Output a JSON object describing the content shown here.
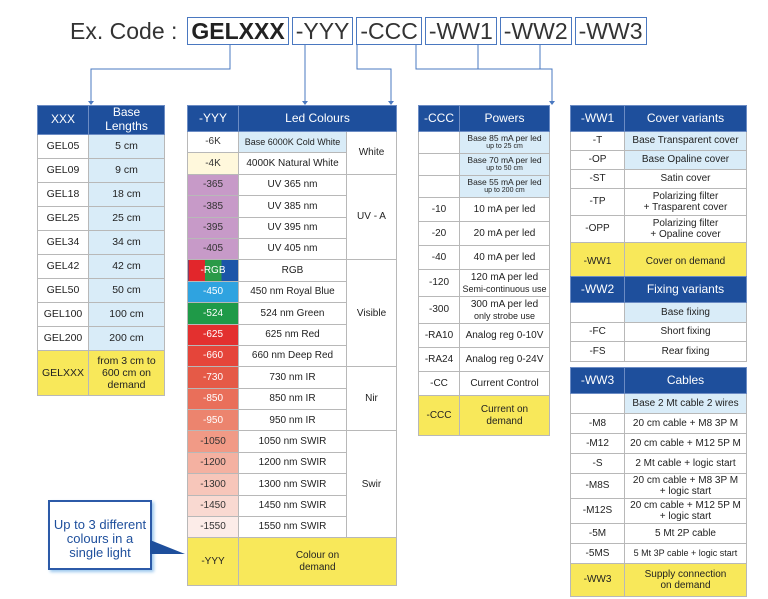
{
  "code": {
    "label": "Ex. Code :",
    "segments": [
      "GELXXX",
      "-YYY",
      "-CCC",
      "-WW1",
      "-WW2",
      "-WW3"
    ]
  },
  "colors": {
    "header_bg": "#1e4f9c",
    "base_highlight": "#d9ecf8",
    "on_demand": "#f8e85a",
    "uv": "#c79ac8"
  },
  "lengths": {
    "headers": [
      "XXX",
      "Base Lengths"
    ],
    "rows": [
      {
        "code": "GEL05",
        "value": "5 cm"
      },
      {
        "code": "GEL09",
        "value": "9 cm"
      },
      {
        "code": "GEL18",
        "value": "18 cm"
      },
      {
        "code": "GEL25",
        "value": "25 cm"
      },
      {
        "code": "GEL34",
        "value": "34 cm"
      },
      {
        "code": "GEL42",
        "value": "42 cm"
      },
      {
        "code": "GEL50",
        "value": "50 cm"
      },
      {
        "code": "GEL100",
        "value": "100 cm"
      },
      {
        "code": "GEL200",
        "value": "200 cm"
      }
    ],
    "demand": {
      "code": "GELXXX",
      "value": "from 3 cm to 600 cm on demand"
    }
  },
  "led": {
    "headers": [
      "-YYY",
      "Led Colours"
    ],
    "rows": [
      {
        "code": "-6K",
        "value": "Base 6000K Cold White"
      },
      {
        "code": "-4K",
        "value": "4000K Natural White"
      },
      {
        "code": "-365",
        "value": "UV 365 nm"
      },
      {
        "code": "-385",
        "value": "UV 385 nm"
      },
      {
        "code": "-395",
        "value": "UV 395 nm"
      },
      {
        "code": "-405",
        "value": "UV 405 nm"
      },
      {
        "code": "-RGB",
        "value": "RGB"
      },
      {
        "code": "-450",
        "value": "450 nm Royal Blue"
      },
      {
        "code": "-524",
        "value": "524 nm Green"
      },
      {
        "code": "-625",
        "value": "625 nm Red"
      },
      {
        "code": "-660",
        "value": "660 nm Deep Red"
      },
      {
        "code": "-730",
        "value": "730 nm IR"
      },
      {
        "code": "-850",
        "value": "850 nm IR"
      },
      {
        "code": "-950",
        "value": "950 nm IR"
      },
      {
        "code": "-1050",
        "value": "1050 nm SWIR"
      },
      {
        "code": "-1200",
        "value": "1200 nm SWIR"
      },
      {
        "code": "-1300",
        "value": "1300 nm SWIR"
      },
      {
        "code": "-1450",
        "value": "1450 nm SWIR"
      },
      {
        "code": "-1550",
        "value": "1550 nm SWIR"
      }
    ],
    "groups": [
      "White",
      "UV - A",
      "Visible",
      "Nir",
      "Swir"
    ],
    "demand": {
      "code": "-YYY",
      "value": "Colour on demand"
    }
  },
  "powers": {
    "headers": [
      "-CCC",
      "Powers"
    ],
    "base_rows": [
      {
        "value": "Base 85 mA per led",
        "note": "up to 25 cm"
      },
      {
        "value": "Base 70 mA per led",
        "note": "up to 50 cm"
      },
      {
        "value": "Base 55 mA per led",
        "note": "up to 200 cm"
      }
    ],
    "rows": [
      {
        "code": "-10",
        "value": "10 mA per led"
      },
      {
        "code": "-20",
        "value": "20 mA per led"
      },
      {
        "code": "-40",
        "value": "40 mA per led"
      },
      {
        "code": "-120",
        "value": "120 mA per led",
        "note": "Semi-continuous use"
      },
      {
        "code": "-300",
        "value": "300 mA per led",
        "note": "only strobe use"
      },
      {
        "code": "-RA10",
        "value": "Analog reg 0-10V"
      },
      {
        "code": "-RA24",
        "value": "Analog reg 0-24V"
      },
      {
        "code": "-CC",
        "value": "Current Control"
      }
    ],
    "demand": {
      "code": "-CCC",
      "value": "Current on demand"
    }
  },
  "covers": {
    "headers": [
      "-WW1",
      "Cover variants"
    ],
    "rows": [
      {
        "code": "-T",
        "value": "Base Transparent cover"
      },
      {
        "code": "-OP",
        "value": "Base Opaline cover"
      },
      {
        "code": "-ST",
        "value": "Satin cover"
      },
      {
        "code": "-TP",
        "value": "Polarizing filter",
        "value2": "+ Trasparent cover"
      },
      {
        "code": "-OPP",
        "value": "Polarizing filter",
        "value2": "+ Opaline cover"
      }
    ],
    "demand": {
      "code": "-WW1",
      "value": "Cover on demand"
    }
  },
  "fixing": {
    "headers": [
      "-WW2",
      "Fixing variants"
    ],
    "rows": [
      {
        "code": "",
        "value": "Base fixing"
      },
      {
        "code": "-FC",
        "value": "Short fixing"
      },
      {
        "code": "-FS",
        "value": "Rear fixing"
      }
    ]
  },
  "cables": {
    "headers": [
      "-WW3",
      "Cables"
    ],
    "rows": [
      {
        "code": "",
        "value": "Base 2 Mt cable 2 wires"
      },
      {
        "code": "-M8",
        "value": "20 cm cable + M8 3P M"
      },
      {
        "code": "-M12",
        "value": "20 cm cable + M12 5P M"
      },
      {
        "code": "-S",
        "value": "2 Mt cable + logic start"
      },
      {
        "code": "-M8S",
        "value": "20 cm cable + M8 3P M",
        "value2": "+ logic start"
      },
      {
        "code": "-M12S",
        "value": "20 cm cable + M12 5P M",
        "value2": "+ logic start"
      },
      {
        "code": "-5M",
        "value": "5 Mt 2P cable"
      },
      {
        "code": "-5MS",
        "value": "5 Mt 3P cable + logic start"
      }
    ],
    "demand": {
      "code": "-WW3",
      "value": "Supply connection on demand"
    }
  },
  "callout": "Up to 3 different colours in a single light"
}
